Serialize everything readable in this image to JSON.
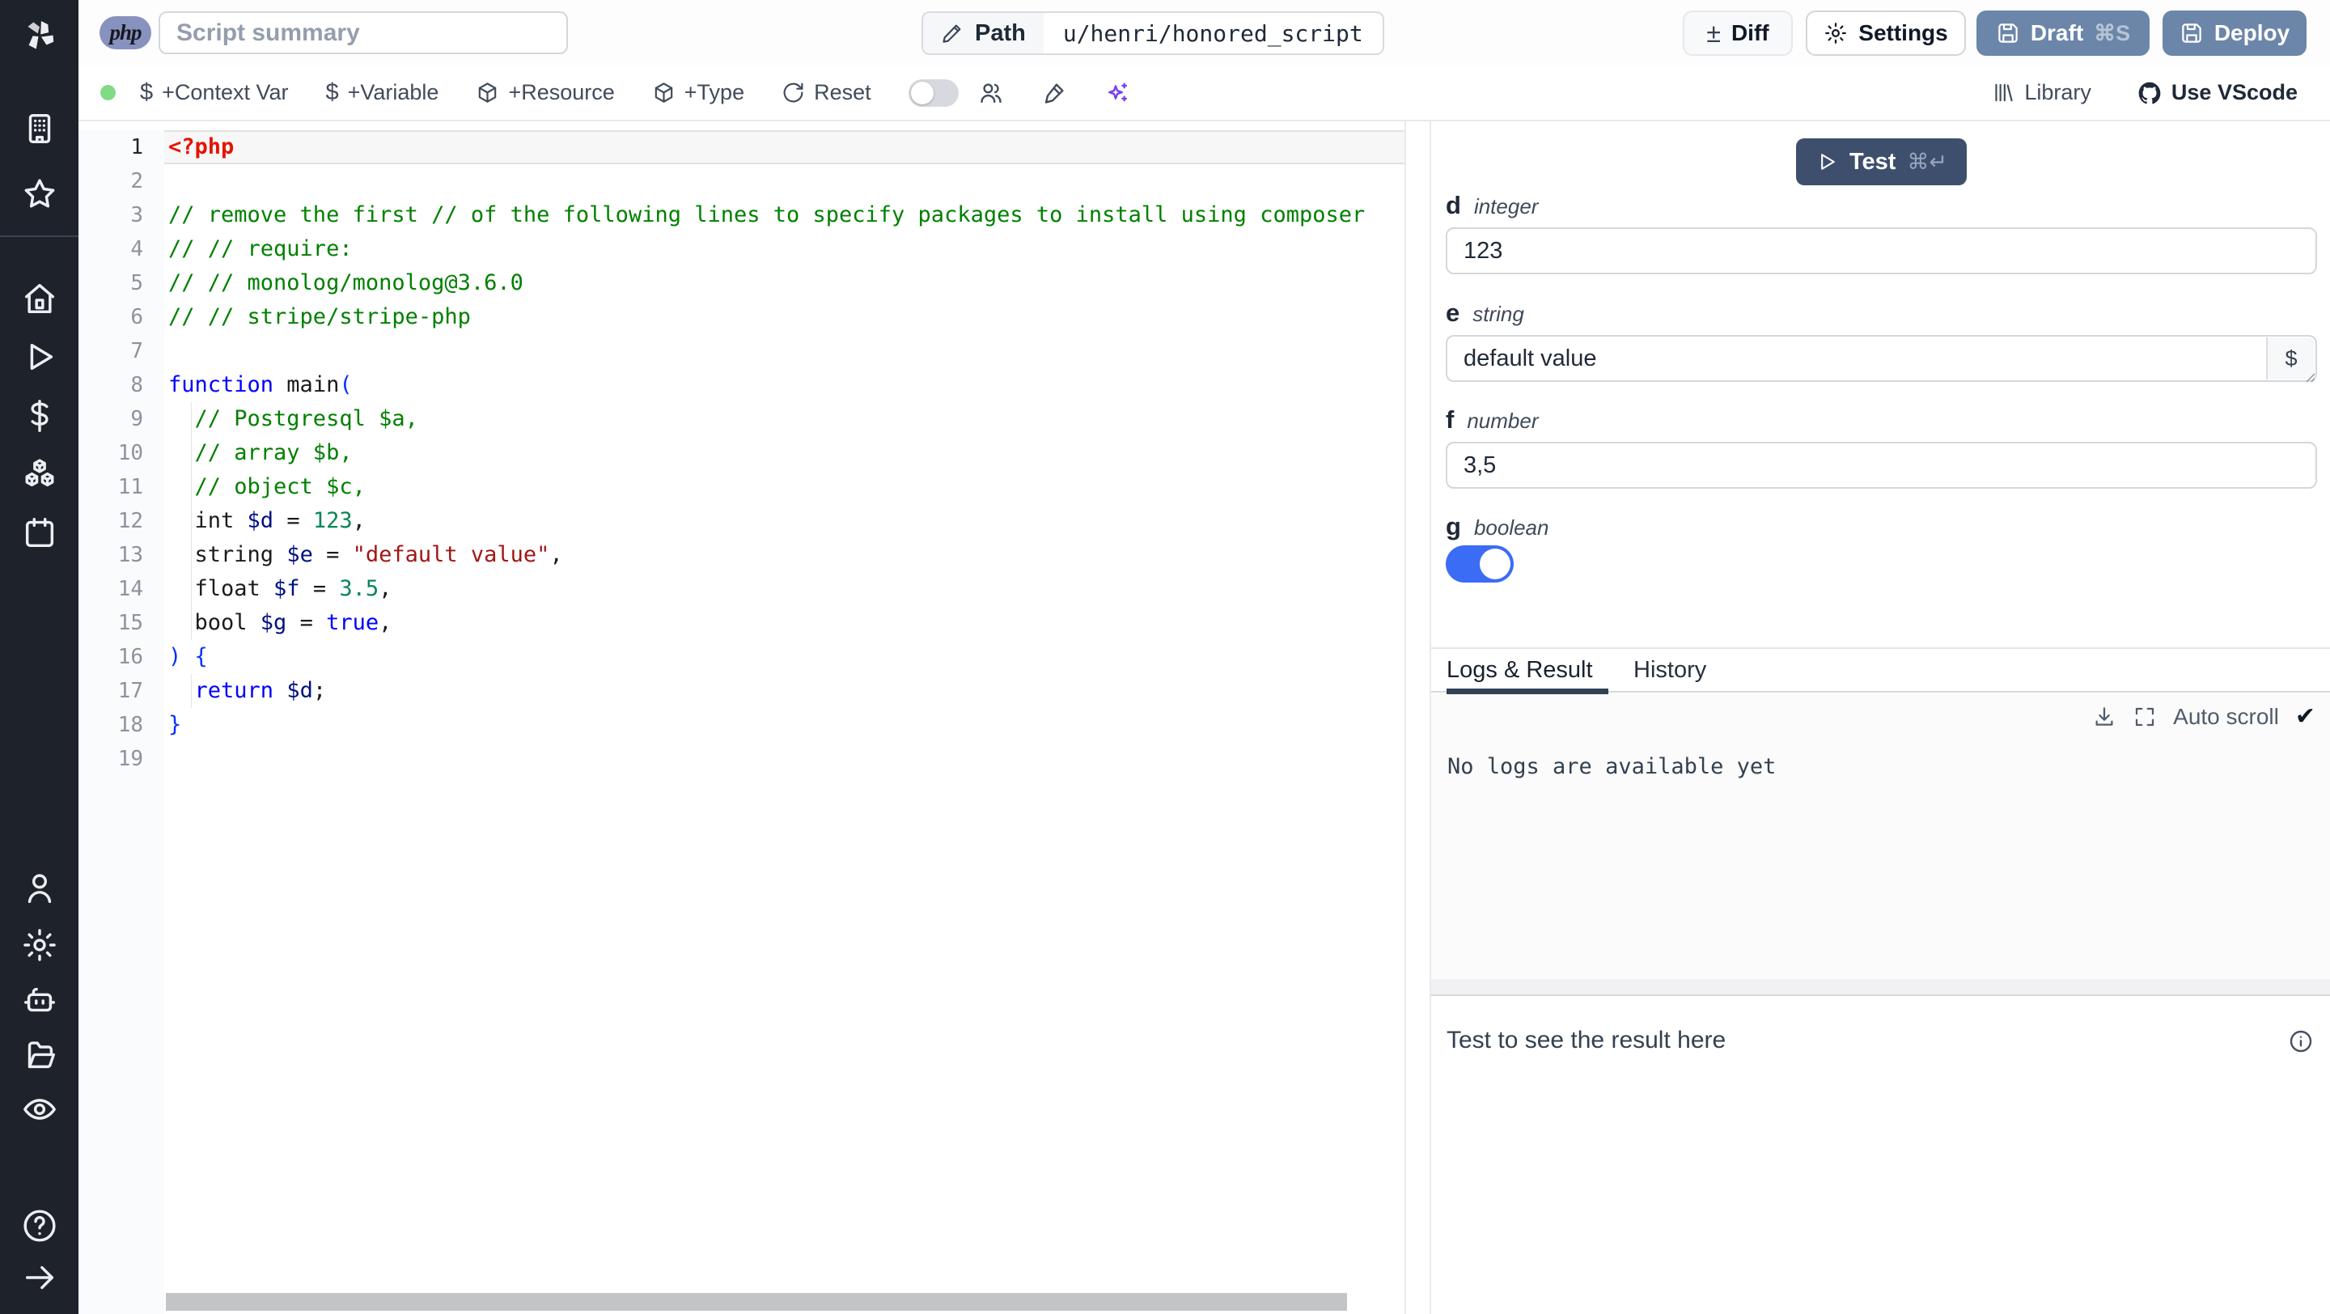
{
  "topbar": {
    "language_badge": "php",
    "summary_placeholder": "Script summary",
    "path_label": "Path",
    "path_value": "u/henri/honored_script",
    "diff_label": "Diff",
    "settings_label": "Settings",
    "draft_label": "Draft",
    "draft_shortcut": "⌘S",
    "deploy_label": "Deploy"
  },
  "toolbar": {
    "add_context_var": "+Context Var",
    "add_variable": "+Variable",
    "add_resource": "+Resource",
    "add_type": "+Type",
    "reset_label": "Reset",
    "library_label": "Library",
    "vscode_label": "Use VScode"
  },
  "sidebar": {
    "icons": [
      "windmill-logo",
      "workspace",
      "favorites",
      "home",
      "runs",
      "variables",
      "resources",
      "schedules",
      "user",
      "settings",
      "workers",
      "folders",
      "audit-logs",
      "help",
      "expand"
    ]
  },
  "editor": {
    "language": "php",
    "active_line": 1,
    "lines": [
      {
        "tokens": [
          {
            "c": "t",
            "t": "<?php"
          }
        ]
      },
      {
        "tokens": []
      },
      {
        "tokens": [
          {
            "c": "c",
            "t": "// remove the first // of the following lines to specify packages to install using composer"
          }
        ]
      },
      {
        "tokens": [
          {
            "c": "c",
            "t": "// // require:"
          }
        ]
      },
      {
        "tokens": [
          {
            "c": "c",
            "t": "// // monolog/monolog@3.6.0"
          }
        ]
      },
      {
        "tokens": [
          {
            "c": "c",
            "t": "// // stripe/stripe-php"
          }
        ]
      },
      {
        "tokens": []
      },
      {
        "tokens": [
          {
            "c": "k",
            "t": "function"
          },
          {
            "c": "d",
            "t": " main"
          },
          {
            "c": "b",
            "t": "("
          }
        ]
      },
      {
        "tokens": [
          {
            "c": "c",
            "t": "  // Postgresql $a,"
          }
        ]
      },
      {
        "tokens": [
          {
            "c": "c",
            "t": "  // array $b,"
          }
        ]
      },
      {
        "tokens": [
          {
            "c": "c",
            "t": "  // object $c,"
          }
        ]
      },
      {
        "tokens": [
          {
            "c": "d",
            "t": "  int "
          },
          {
            "c": "v",
            "t": "$d"
          },
          {
            "c": "d",
            "t": " = "
          },
          {
            "c": "n",
            "t": "123"
          },
          {
            "c": "d",
            "t": ","
          }
        ]
      },
      {
        "tokens": [
          {
            "c": "d",
            "t": "  string "
          },
          {
            "c": "v",
            "t": "$e"
          },
          {
            "c": "d",
            "t": " = "
          },
          {
            "c": "s",
            "t": "\"default value\""
          },
          {
            "c": "d",
            "t": ","
          }
        ]
      },
      {
        "tokens": [
          {
            "c": "d",
            "t": "  float "
          },
          {
            "c": "v",
            "t": "$f"
          },
          {
            "c": "d",
            "t": " = "
          },
          {
            "c": "n",
            "t": "3.5"
          },
          {
            "c": "d",
            "t": ","
          }
        ]
      },
      {
        "tokens": [
          {
            "c": "d",
            "t": "  bool "
          },
          {
            "c": "v",
            "t": "$g"
          },
          {
            "c": "d",
            "t": " = "
          },
          {
            "c": "k",
            "t": "true"
          },
          {
            "c": "d",
            "t": ","
          }
        ]
      },
      {
        "tokens": [
          {
            "c": "b",
            "t": ") {"
          }
        ]
      },
      {
        "tokens": [
          {
            "c": "d",
            "t": "  "
          },
          {
            "c": "k",
            "t": "return"
          },
          {
            "c": "d",
            "t": " "
          },
          {
            "c": "v",
            "t": "$d"
          },
          {
            "c": "d",
            "t": ";"
          }
        ]
      },
      {
        "tokens": [
          {
            "c": "b",
            "t": "}"
          }
        ]
      },
      {
        "tokens": []
      }
    ]
  },
  "runner": {
    "test_label": "Test",
    "test_shortcut": "⌘↵",
    "fields": [
      {
        "name": "d",
        "type": "integer",
        "value": "123"
      },
      {
        "name": "e",
        "type": "string",
        "value": "default value"
      },
      {
        "name": "f",
        "type": "number",
        "value": "3,5"
      },
      {
        "name": "g",
        "type": "boolean",
        "value": "true"
      }
    ],
    "dollar_button": "$",
    "tabs": {
      "logs": "Logs & Result",
      "history": "History"
    },
    "active_tab": "Logs & Result",
    "autoscroll_label": "Auto scroll",
    "logs_empty": "No logs are available yet",
    "result_placeholder": "Test to see the result here"
  },
  "colors": {
    "sidebar_bg": "#1e222b",
    "primary_button": "#6c86a9",
    "test_button": "#3e4f6e",
    "toggle_on": "#3b6cf5",
    "status_dot": "#80da86",
    "tab_underline": "#334155",
    "ai_accent": "#7a3ff2"
  }
}
